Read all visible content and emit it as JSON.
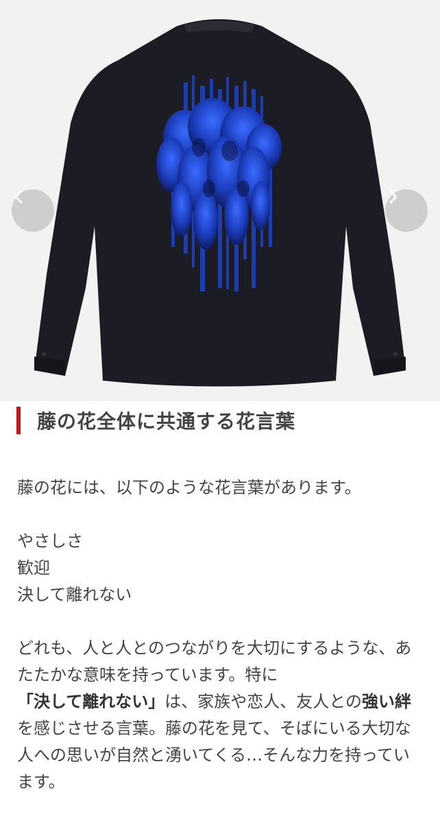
{
  "carousel": {
    "image_alt": "Black long-sleeve shirt, back view, with blue wisteria print",
    "prev_icon": "chevron-left-icon",
    "next_icon": "chevron-right-icon"
  },
  "section": {
    "heading": "藤の花全体に共通する花言葉",
    "accent_color": "#c8151b",
    "intro": "藤の花には、以下のような花言葉があります。",
    "meanings": [
      "やさしさ",
      "歓迎",
      "決して離れない"
    ],
    "paragraph": {
      "part1": "どれも、人と人とのつながりを大切にするような、あたたかな意味を持っています。特に",
      "bold1": "「決して離れない」",
      "part2": "は、家族や恋人、友人との",
      "bold2": "強い絆",
      "part3": "を感じさせる言葉。藤の花を見て、そばにいる大切な人への思いが自然と湧いてくる…そんな力を持っています。"
    }
  }
}
